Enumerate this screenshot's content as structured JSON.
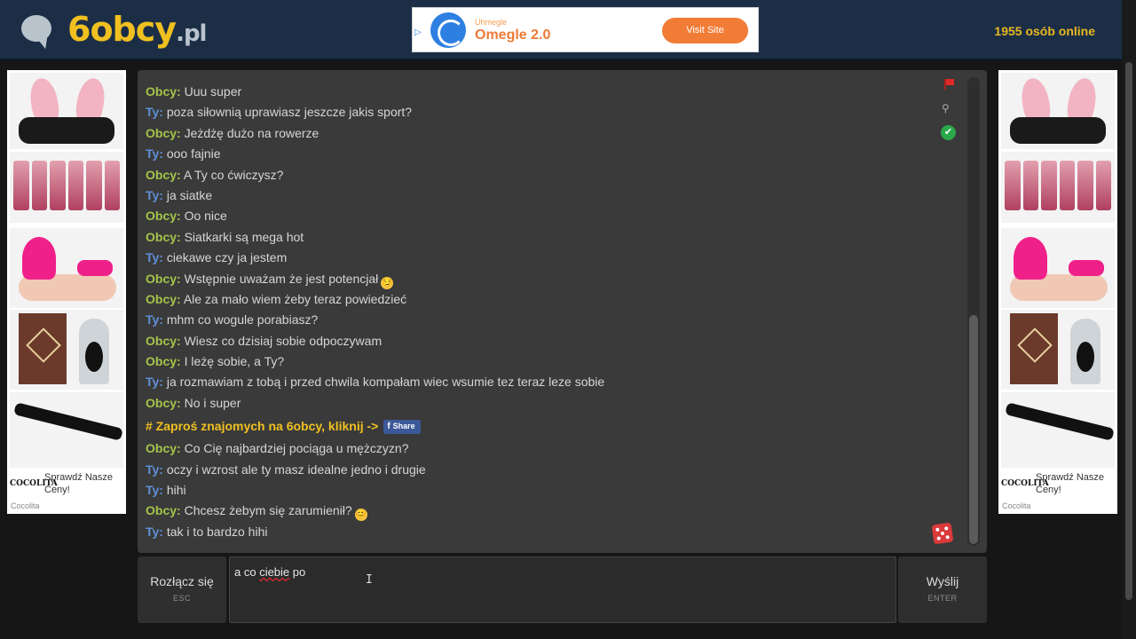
{
  "header": {
    "logo_text_num": "6",
    "logo_text_word": "obcy",
    "logo_text_tld": ".pl",
    "online_count": "1955 osób online"
  },
  "top_ad": {
    "subtitle": "Uhmegle",
    "title": "Omegle 2.0",
    "button_label": "Visit Site",
    "choice_icon": "adchoices-icon"
  },
  "side_ads": {
    "caption": "Sprawdź Nasze Ceny!",
    "brand": "COCOLITA",
    "source": "Cocolita"
  },
  "chat": {
    "messages": [
      {
        "sender": "Obcy:",
        "role": "obcy",
        "text": "Uuu super"
      },
      {
        "sender": "Ty:",
        "role": "ty",
        "text": "poza siłownią uprawiasz jeszcze jakis sport?"
      },
      {
        "sender": "Obcy:",
        "role": "obcy",
        "text": "Jeżdżę dużo na rowerze"
      },
      {
        "sender": "Ty:",
        "role": "ty",
        "text": "ooo fajnie"
      },
      {
        "sender": "Obcy:",
        "role": "obcy",
        "text": "A Ty co ćwiczysz?"
      },
      {
        "sender": "Ty:",
        "role": "ty",
        "text": "ja siatke"
      },
      {
        "sender": "Obcy:",
        "role": "obcy",
        "text": "Oo nice"
      },
      {
        "sender": "Obcy:",
        "role": "obcy",
        "text": "Siatkarki są mega hot"
      },
      {
        "sender": "Ty:",
        "role": "ty",
        "text": "ciekawe czy ja jestem"
      },
      {
        "sender": "Obcy:",
        "role": "obcy",
        "text": "Wstępnie uważam że jest potencjał",
        "emoji": "😏"
      },
      {
        "sender": "Obcy:",
        "role": "obcy",
        "text": "Ale za mało wiem żeby teraz powiedzieć"
      },
      {
        "sender": "Ty:",
        "role": "ty",
        "text": "mhm co wogule porabiasz?"
      },
      {
        "sender": "Obcy:",
        "role": "obcy",
        "text": "Wiesz co dzisiaj sobie odpoczywam"
      },
      {
        "sender": "Obcy:",
        "role": "obcy",
        "text": "I leżę sobie, a Ty?"
      },
      {
        "sender": "Ty:",
        "role": "ty",
        "text": "ja rozmawiam z tobą i przed chwila kompałam wiec wsumie tez teraz leze sobie"
      },
      {
        "sender": "Obcy:",
        "role": "obcy",
        "text": "No i super"
      }
    ],
    "invite_text": "# Zaproś znajomych na 6obcy, kliknij ->",
    "share_label": "Share",
    "share_icon_letter": "f",
    "messages_after": [
      {
        "sender": "Obcy:",
        "role": "obcy",
        "text": "Co Cię najbardziej pociąga u mężczyzn?"
      },
      {
        "sender": "Ty:",
        "role": "ty",
        "text": "oczy i wzrost ale ty masz idealne jedno i drugie"
      },
      {
        "sender": "Ty:",
        "role": "ty",
        "text": "hihi"
      },
      {
        "sender": "Obcy:",
        "role": "obcy",
        "text": "Chcesz żebym się zarumienił?",
        "emoji": "😊"
      },
      {
        "sender": "Ty:",
        "role": "ty",
        "text": "tak i to bardzo hihi"
      }
    ],
    "icons": {
      "report": "flag-icon",
      "search": "magnifier-icon",
      "sound": "sound-on-icon",
      "random": "dice-icon"
    }
  },
  "controls": {
    "disconnect_label": "Rozłącz się",
    "disconnect_hint": "ESC",
    "send_label": "Wyślij",
    "send_hint": "ENTER",
    "input_value_prefix": "a co ",
    "input_value_misspelled": "ciebie",
    "input_value_suffix": " po"
  },
  "colors": {
    "obcy": "#a5c44a",
    "ty": "#5f8fd6",
    "accent": "#f0c020"
  }
}
